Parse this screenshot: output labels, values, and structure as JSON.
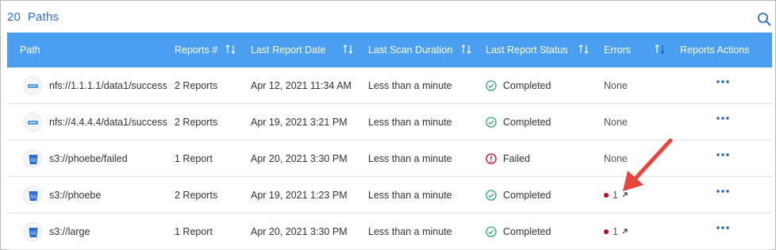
{
  "header": {
    "count": "20",
    "title": "Paths"
  },
  "columns": {
    "path": "Path",
    "reports": "Reports #",
    "last_report_date": "Last Report Date",
    "last_scan_duration": "Last Scan Duration",
    "last_report_status": "Last Report Status",
    "errors": "Errors",
    "reports_actions": "Reports Actions"
  },
  "rows": [
    {
      "icon": "nfs-icon",
      "path": "nfs://1.1.1.1/data1/success",
      "reports": "2 Reports",
      "date": "Apr 12, 2021 11:34 AM",
      "duration": "Less than a minute",
      "status": "Completed",
      "status_icon": "check-circle-icon",
      "errors": "None",
      "error_count": null
    },
    {
      "icon": "nfs-icon",
      "path": "nfs://4.4.4.4/data1/success",
      "reports": "2 Reports",
      "date": "Apr 19, 2021 3:21 PM",
      "duration": "Less than a minute",
      "status": "Completed",
      "status_icon": "check-circle-icon",
      "errors": "None",
      "error_count": null
    },
    {
      "icon": "s3-bucket-icon",
      "path": "s3://phoebe/failed",
      "reports": "1 Report",
      "date": "Apr 20, 2021 3:30 PM",
      "duration": "Less than a minute",
      "status": "Failed",
      "status_icon": "error-circle-icon",
      "errors": "None",
      "error_count": null
    },
    {
      "icon": "s3-bucket-icon",
      "path": "s3://phoebe",
      "reports": "2 Reports",
      "date": "Apr 19, 2021 1:23 PM",
      "duration": "Less than a minute",
      "status": "Completed",
      "status_icon": "check-circle-icon",
      "errors": null,
      "error_count": "1"
    },
    {
      "icon": "s3-bucket-icon",
      "path": "s3://large",
      "reports": "1 Report",
      "date": "Apr 20, 2021 3:30 PM",
      "duration": "Less than a minute",
      "status": "Completed",
      "status_icon": "check-circle-icon",
      "errors": null,
      "error_count": "1"
    }
  ],
  "colors": {
    "header_bg": "#4a9ff0",
    "accent": "#2b6fd6",
    "completed": "#2ea77a",
    "failed": "#d0021b",
    "annotation_arrow": "#e8453c"
  }
}
